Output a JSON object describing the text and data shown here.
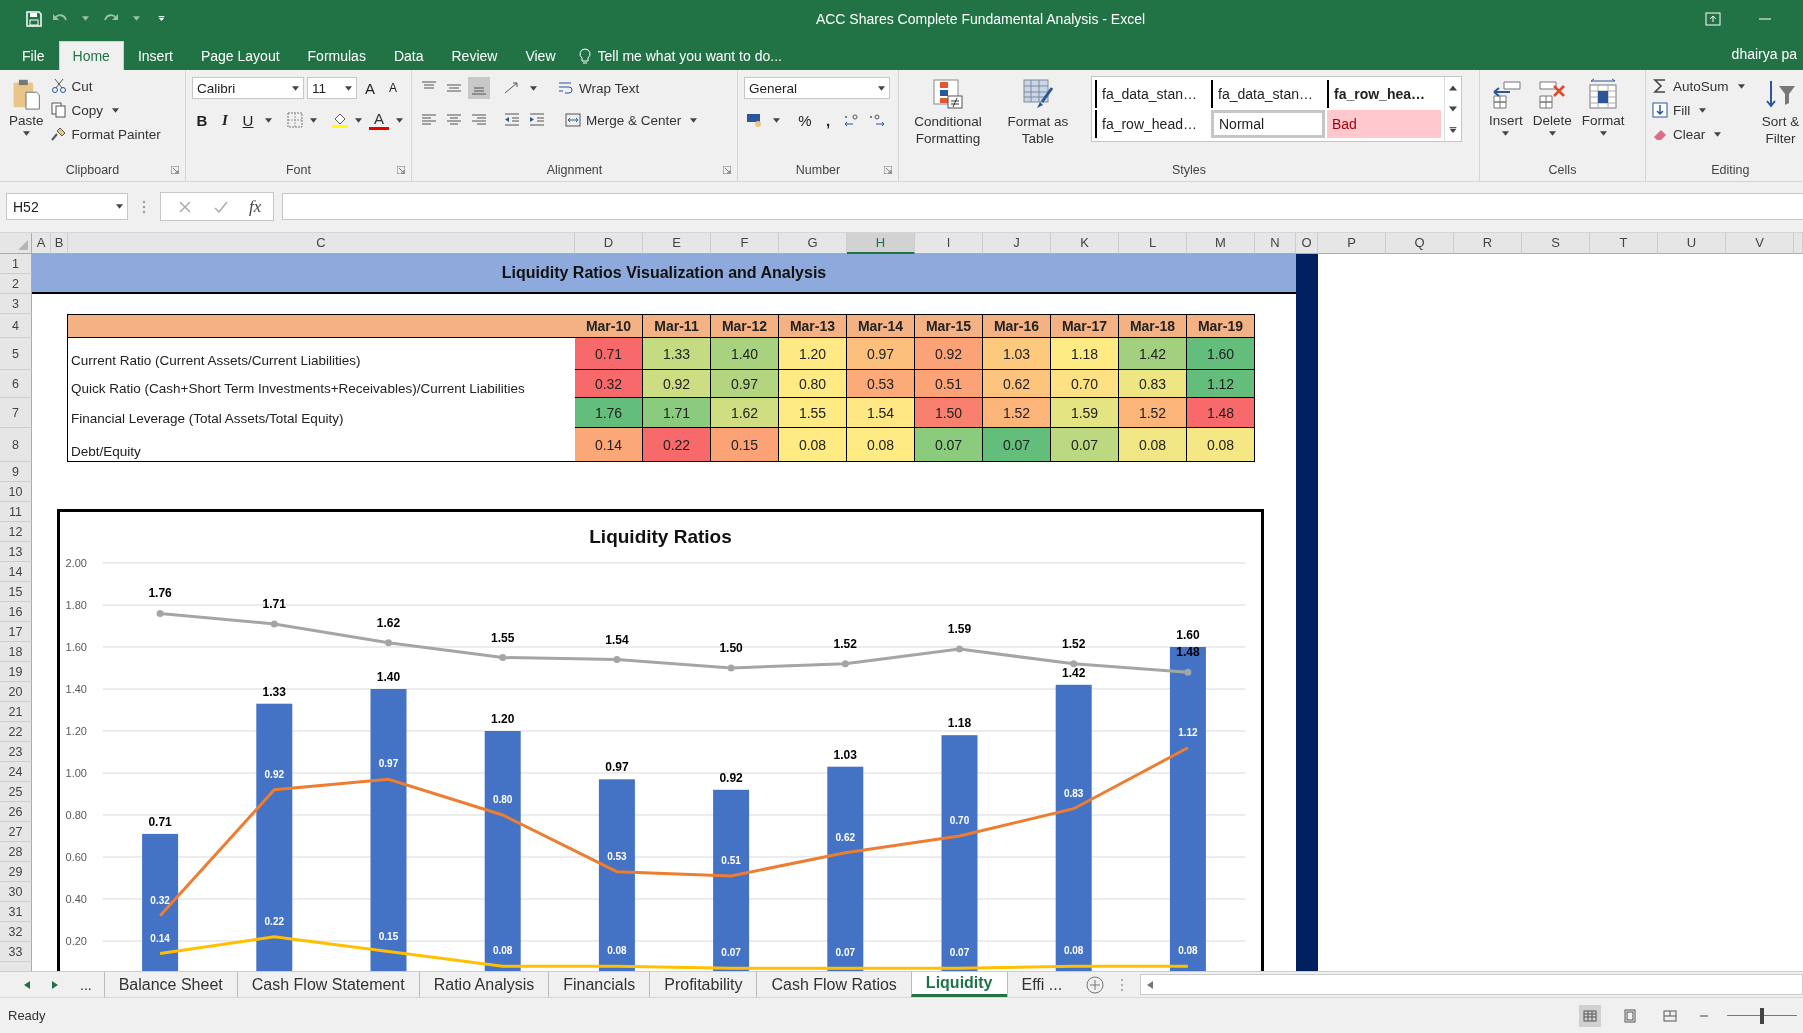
{
  "window": {
    "title": "ACC Shares Complete Fundamental Analysis - Excel",
    "user": "dhairya pa"
  },
  "ribbon_tabs": [
    {
      "label": "File",
      "selected": false
    },
    {
      "label": "Home",
      "selected": true
    },
    {
      "label": "Insert",
      "selected": false
    },
    {
      "label": "Page Layout",
      "selected": false
    },
    {
      "label": "Formulas",
      "selected": false
    },
    {
      "label": "Data",
      "selected": false
    },
    {
      "label": "Review",
      "selected": false
    },
    {
      "label": "View",
      "selected": false
    }
  ],
  "tell_me": {
    "placeholder": "Tell me what you want to do..."
  },
  "clipboard": {
    "paste": "Paste",
    "cut": "Cut",
    "copy": "Copy",
    "format_painter": "Format Painter",
    "label": "Clipboard"
  },
  "font": {
    "name": "Calibri",
    "size": "11",
    "grow": "A",
    "shrink": "A",
    "bold": "B",
    "italic": "I",
    "underline": "U",
    "color_letter": "A",
    "label": "Font"
  },
  "alignment": {
    "wrap": "Wrap Text",
    "merge": "Merge & Center",
    "label": "Alignment"
  },
  "number": {
    "format": "General",
    "percent": "%",
    "comma": ",",
    "label": "Number"
  },
  "styles": {
    "conditional": "Conditional Formatting",
    "format_table": "Format as Table",
    "label": "Styles",
    "gallery": [
      {
        "label": "fa_data_stan…",
        "kind": "plain"
      },
      {
        "label": "fa_data_stan…",
        "kind": "plain"
      },
      {
        "label": "fa_row_hea…",
        "kind": "bold"
      },
      {
        "label": "fa_row_head…",
        "kind": "plain"
      },
      {
        "label": "Normal",
        "kind": "normal"
      },
      {
        "label": "Bad",
        "kind": "bad"
      }
    ]
  },
  "cells": {
    "insert": "Insert",
    "delete": "Delete",
    "format": "Format",
    "label": "Cells"
  },
  "editing": {
    "autosum": "AutoSum",
    "fill": "Fill",
    "clear": "Clear",
    "sort": "Sort & Filter",
    "label": "Editing"
  },
  "formula_bar": {
    "name_box": "H52",
    "fx": "fx"
  },
  "columns": [
    {
      "label": "A",
      "selected": false
    },
    {
      "label": "B",
      "selected": false
    },
    {
      "label": "C",
      "selected": false
    },
    {
      "label": "D",
      "selected": false
    },
    {
      "label": "E",
      "selected": false
    },
    {
      "label": "F",
      "selected": false
    },
    {
      "label": "G",
      "selected": false
    },
    {
      "label": "H",
      "selected": true
    },
    {
      "label": "I",
      "selected": false
    },
    {
      "label": "J",
      "selected": false
    },
    {
      "label": "K",
      "selected": false
    },
    {
      "label": "L",
      "selected": false
    },
    {
      "label": "M",
      "selected": false
    },
    {
      "label": "N",
      "selected": false
    },
    {
      "label": "O",
      "selected": false
    },
    {
      "label": "P",
      "selected": false
    },
    {
      "label": "Q",
      "selected": false
    },
    {
      "label": "R",
      "selected": false
    },
    {
      "label": "S",
      "selected": false
    },
    {
      "label": "T",
      "selected": false
    },
    {
      "label": "U",
      "selected": false
    },
    {
      "label": "V",
      "selected": false
    }
  ],
  "rows": [
    "1",
    "2",
    "3",
    "4",
    "5",
    "6",
    "7",
    "8",
    "9",
    "10",
    "11",
    "12",
    "13",
    "14",
    "15",
    "16",
    "17",
    "18",
    "19",
    "20",
    "21",
    "22",
    "23",
    "24",
    "25",
    "26",
    "27",
    "28",
    "29",
    "30",
    "31",
    "32",
    "33"
  ],
  "sheet": {
    "title": "Liquidity Ratios Visualization and Analysis",
    "headers": [
      "Mar-10",
      "Mar-11",
      "Mar-12",
      "Mar-13",
      "Mar-14",
      "Mar-15",
      "Mar-16",
      "Mar-17",
      "Mar-18",
      "Mar-19"
    ],
    "table": [
      {
        "label": "Current Ratio (Current Assets/Current Liabilities)",
        "cells": [
          {
            "value": "0.71",
            "color": "#f8696b"
          },
          {
            "value": "1.33",
            "color": "#c4db81"
          },
          {
            "value": "1.40",
            "color": "#a9d27f"
          },
          {
            "value": "1.20",
            "color": "#ffe984"
          },
          {
            "value": "0.97",
            "color": "#fdc07c"
          },
          {
            "value": "0.92",
            "color": "#fba276"
          },
          {
            "value": "1.03",
            "color": "#fdca7d"
          },
          {
            "value": "1.18",
            "color": "#ffeb84"
          },
          {
            "value": "1.42",
            "color": "#a2d07f"
          },
          {
            "value": "1.60",
            "color": "#63be7b"
          }
        ]
      },
      {
        "label": "Quick Ratio (Cash+Short Term Investments+Receivables)/Current Liabilities",
        "cells": [
          {
            "value": "0.32",
            "color": "#f8696b"
          },
          {
            "value": "0.92",
            "color": "#cddd82"
          },
          {
            "value": "0.97",
            "color": "#b4d580"
          },
          {
            "value": "0.80",
            "color": "#ffeb84"
          },
          {
            "value": "0.53",
            "color": "#fcaa78"
          },
          {
            "value": "0.51",
            "color": "#fba276"
          },
          {
            "value": "0.62",
            "color": "#fdc47d"
          },
          {
            "value": "0.70",
            "color": "#fee182"
          },
          {
            "value": "0.83",
            "color": "#ede683"
          },
          {
            "value": "1.12",
            "color": "#63be7b"
          }
        ]
      },
      {
        "label": "Financial Leverage (Total Assets/Total Equity)",
        "cells": [
          {
            "value": "1.76",
            "color": "#63be7b"
          },
          {
            "value": "1.71",
            "color": "#8acb7e"
          },
          {
            "value": "1.62",
            "color": "#d0de82"
          },
          {
            "value": "1.55",
            "color": "#ffeb84"
          },
          {
            "value": "1.54",
            "color": "#ffe784"
          },
          {
            "value": "1.50",
            "color": "#f9806f"
          },
          {
            "value": "1.52",
            "color": "#fcb479"
          },
          {
            "value": "1.59",
            "color": "#e5e483"
          },
          {
            "value": "1.52",
            "color": "#fcb479"
          },
          {
            "value": "1.48",
            "color": "#f8696b"
          }
        ]
      },
      {
        "label": "Debt/Equity",
        "cells": [
          {
            "value": "0.14",
            "color": "#fba777"
          },
          {
            "value": "0.22",
            "color": "#f8696b"
          },
          {
            "value": "0.15",
            "color": "#fba276"
          },
          {
            "value": "0.08",
            "color": "#ffeb84"
          },
          {
            "value": "0.08",
            "color": "#ffeb84"
          },
          {
            "value": "0.07",
            "color": "#8acb7e"
          },
          {
            "value": "0.07",
            "color": "#63be7b"
          },
          {
            "value": "0.07",
            "color": "#bcd881"
          },
          {
            "value": "0.08",
            "color": "#f0e683"
          },
          {
            "value": "0.08",
            "color": "#f5e884"
          }
        ]
      }
    ]
  },
  "chart": {
    "chart_data": {
      "type": "bar",
      "title": "Liquidity Ratios",
      "ylim": [
        0,
        2
      ],
      "grid": true,
      "yticks": [
        {
          "value": 0.2,
          "label": "0.20"
        },
        {
          "value": 0.4,
          "label": "0.40"
        },
        {
          "value": 0.6,
          "label": "0.60"
        },
        {
          "value": 0.8,
          "label": "0.80"
        },
        {
          "value": 1.0,
          "label": "1.00"
        },
        {
          "value": 1.2,
          "label": "1.20"
        },
        {
          "value": 1.4,
          "label": "1.40"
        },
        {
          "value": 1.6,
          "label": "1.60"
        },
        {
          "value": 1.8,
          "label": "1.80"
        },
        {
          "value": 2.0,
          "label": "2.00"
        }
      ],
      "series": [
        {
          "color": "#4472c4",
          "values": [
            0.71,
            1.33,
            1.4,
            1.2,
            0.97,
            0.92,
            1.03,
            1.18,
            1.42,
            1.6
          ],
          "value_labels": [
            "0.71",
            "1.33",
            "1.40",
            "1.20",
            "0.97",
            "0.92",
            "1.03",
            "1.18",
            "1.42",
            "1.60"
          ]
        },
        {
          "type": "line",
          "color": "#ed7d31",
          "values": [
            0.32,
            0.92,
            0.97,
            0.8,
            0.53,
            0.51,
            0.62,
            0.7,
            0.83,
            1.12
          ],
          "value_labels": [
            "0.32",
            "0.92",
            "0.97",
            "0.80",
            "0.53",
            "0.51",
            "0.62",
            "0.70",
            "0.83",
            "1.12"
          ]
        },
        {
          "type": "line",
          "color": "#a5a5a5",
          "marker": "circle",
          "values": [
            1.76,
            1.71,
            1.62,
            1.55,
            1.54,
            1.5,
            1.52,
            1.59,
            1.52,
            1.48
          ],
          "value_labels": [
            "1.76",
            "1.71",
            "1.62",
            "1.55",
            "1.54",
            "1.50",
            "1.52",
            "1.59",
            "1.52",
            "1.48"
          ]
        },
        {
          "type": "line",
          "color": "#ffc000",
          "values": [
            0.14,
            0.22,
            0.15,
            0.08,
            0.08,
            0.07,
            0.07,
            0.07,
            0.08,
            0.08
          ],
          "value_labels": [
            "0.14",
            "0.22",
            "0.15",
            "0.08",
            "0.08",
            "0.07",
            "0.07",
            "0.07",
            "0.08",
            "0.08"
          ]
        }
      ]
    }
  },
  "sheet_tabs": {
    "overflow": "...",
    "tabs": [
      {
        "label": "Balance Sheet",
        "selected": false
      },
      {
        "label": "Cash Flow Statement",
        "selected": false
      },
      {
        "label": "Ratio Analysis",
        "selected": false
      },
      {
        "label": "Financials",
        "selected": false
      },
      {
        "label": "Profitability",
        "selected": false
      },
      {
        "label": "Cash Flow Ratios",
        "selected": false
      },
      {
        "label": "Liquidity",
        "selected": true
      },
      {
        "label": "Effi ...",
        "selected": false
      }
    ]
  },
  "status_bar": {
    "text": "Ready",
    "zoom": {
      "level": 0.5
    }
  }
}
